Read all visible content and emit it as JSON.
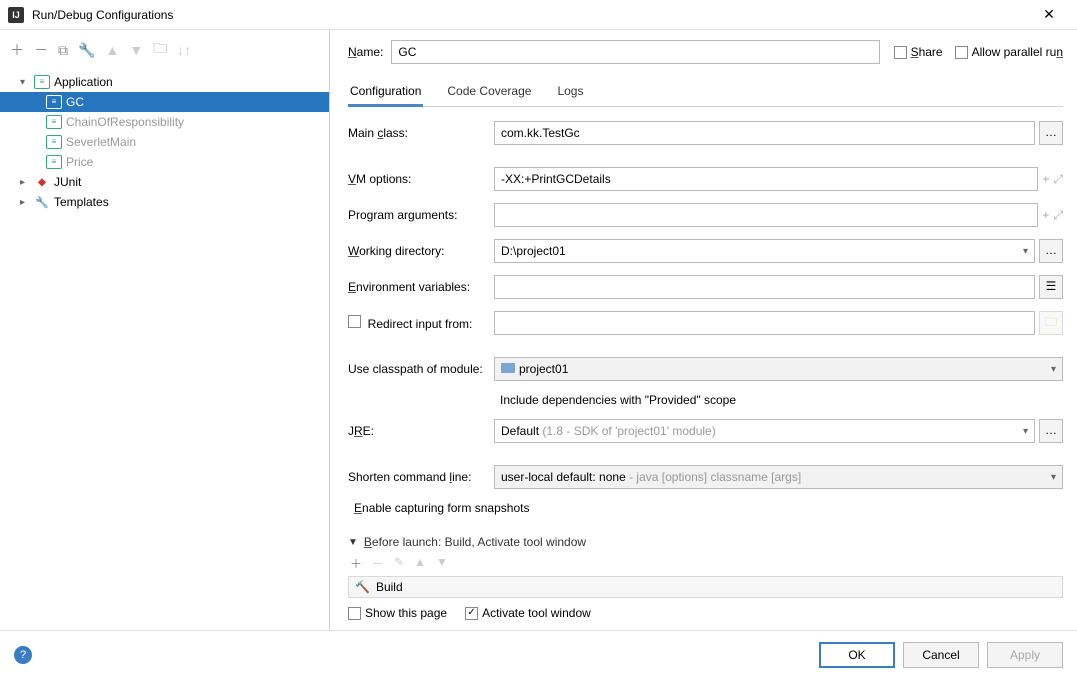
{
  "window": {
    "title": "Run/Debug Configurations"
  },
  "tree": {
    "application": "Application",
    "items": [
      "GC",
      "ChainOfResponsibility",
      "SeverletMain",
      "Price"
    ],
    "junit": "JUnit",
    "templates": "Templates"
  },
  "top": {
    "name_label": "Name:",
    "name_value": "GC",
    "share": "Share",
    "allow_parallel": "Allow parallel run"
  },
  "tabs": {
    "configuration": "Configuration",
    "coverage": "Code Coverage",
    "logs": "Logs"
  },
  "form": {
    "main_class_label": "Main class:",
    "main_class_value": "com.kk.TestGc",
    "vm_label": "VM options:",
    "vm_value": "-XX:+PrintGCDetails",
    "prog_args_label": "Program arguments:",
    "prog_args_value": "",
    "workdir_label": "Working directory:",
    "workdir_value": "D:\\project01",
    "env_label": "Environment variables:",
    "env_value": "",
    "redirect_label": "Redirect input from:",
    "classpath_label": "Use classpath of module:",
    "classpath_value": "project01",
    "include_provided": "Include dependencies with \"Provided\" scope",
    "jre_label": "JRE:",
    "jre_value": "Default",
    "jre_hint": "(1.8 - SDK of 'project01' module)",
    "shorten_label": "Shorten command line:",
    "shorten_value": "user-local default: none",
    "shorten_hint": "- java [options] classname [args]",
    "enable_snapshots": "Enable capturing form snapshots"
  },
  "before": {
    "header": "Before launch: Build, Activate tool window",
    "build": "Build",
    "show_page": "Show this page",
    "activate": "Activate tool window"
  },
  "footer": {
    "ok": "OK",
    "cancel": "Cancel",
    "apply": "Apply"
  }
}
